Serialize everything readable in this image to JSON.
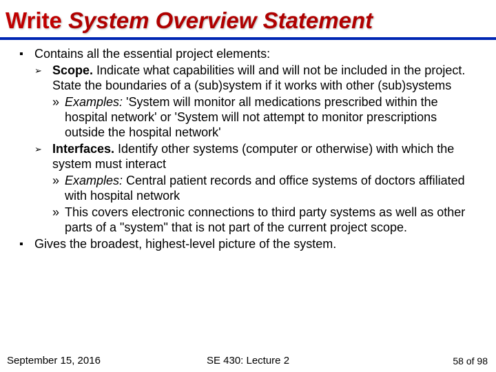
{
  "title_w1": "Write",
  "title_rest": "System Overview Statement",
  "bullets": {
    "b1a": "Contains all the essential project elements:",
    "scope_label": "Scope.",
    "scope_text": " Indicate what capabilities will and will not be included in the project. State the boundaries of a (sub)system if it works with other (sub)systems",
    "examples_label": "Examples:",
    "scope_ex": " 'System will monitor all medications prescribed within the hospital network' or 'System will not attempt to monitor prescriptions outside the hospital network'",
    "interfaces_label": "Interfaces.",
    "interfaces_text": " Identify other systems (computer or otherwise) with which the system must interact",
    "interfaces_ex": " Central patient records and office systems of doctors affiliated with hospital network",
    "interfaces_note": "This covers electronic connections to third party systems as well as other parts of a \"system\" that is not part of the current project scope.",
    "b1b": "Gives the broadest, highest-level picture of the system."
  },
  "footer": {
    "left": "September 15, 2016",
    "center": "SE 430: Lecture 2",
    "right": "58 of 98"
  }
}
